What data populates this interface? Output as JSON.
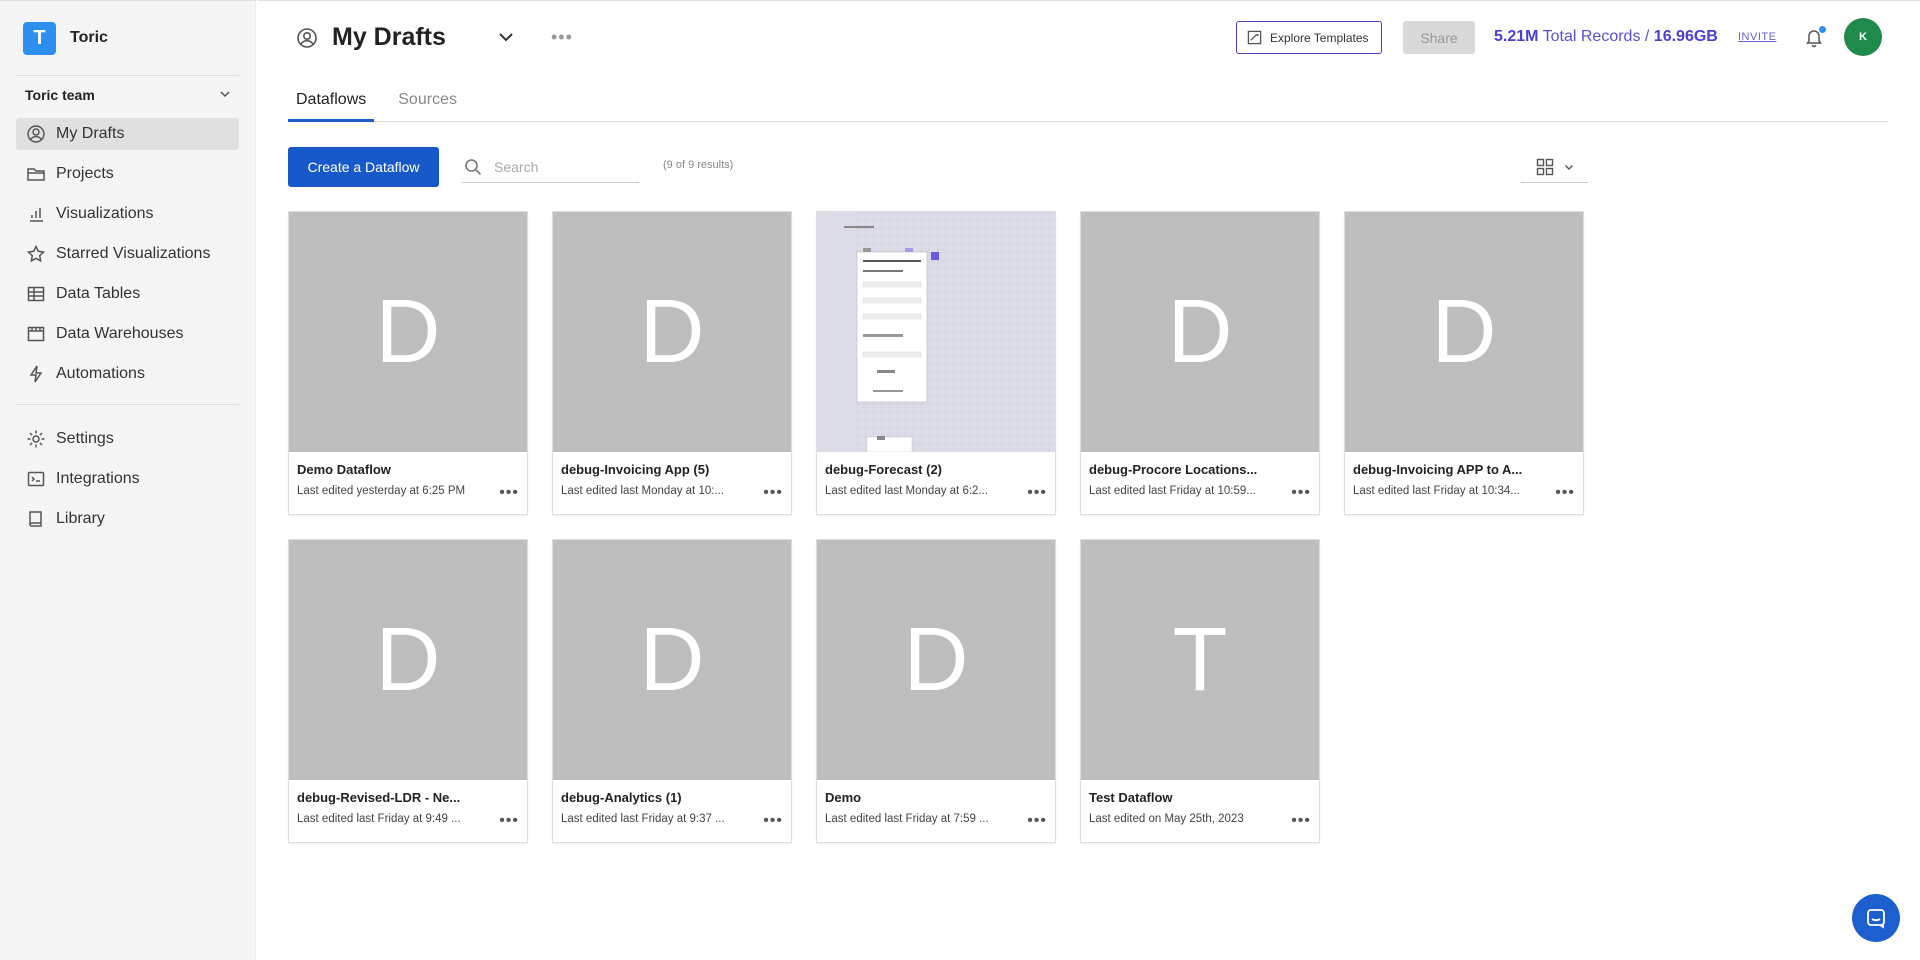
{
  "brand": {
    "logo_letter": "T",
    "name": "Toric"
  },
  "team": {
    "name": "Toric team"
  },
  "sidebar": {
    "items": [
      {
        "label": "My Drafts",
        "icon": "user-circle-icon",
        "active": true
      },
      {
        "label": "Projects",
        "icon": "folder-icon"
      },
      {
        "label": "Visualizations",
        "icon": "chart-icon"
      },
      {
        "label": "Starred Visualizations",
        "icon": "star-icon"
      },
      {
        "label": "Data Tables",
        "icon": "table-icon"
      },
      {
        "label": "Data Warehouses",
        "icon": "warehouse-icon"
      },
      {
        "label": "Automations",
        "icon": "lightning-icon"
      }
    ],
    "secondary": [
      {
        "label": "Settings",
        "icon": "gear-icon"
      },
      {
        "label": "Integrations",
        "icon": "integrations-icon"
      },
      {
        "label": "Library",
        "icon": "book-icon"
      }
    ]
  },
  "header": {
    "title": "My Drafts",
    "explore_label": "Explore Templates",
    "share_label": "Share",
    "records_count": "5.21M",
    "records_label": "Total Records /",
    "storage": "16.96GB",
    "invite_label": "INVITE",
    "avatar_initial": "K"
  },
  "tabs": [
    {
      "label": "Dataflows",
      "active": true
    },
    {
      "label": "Sources",
      "active": false
    }
  ],
  "toolbar": {
    "create_label": "Create a Dataflow",
    "search_placeholder": "Search",
    "results_text": "(9 of 9 results)"
  },
  "cards": [
    {
      "letter": "D",
      "name": "Demo Dataflow",
      "meta": "Last edited yesterday at 6:25 PM"
    },
    {
      "letter": "D",
      "name": "debug-Invoicing App (5)",
      "meta": "Last edited last Monday at 10:..."
    },
    {
      "letter": "",
      "name": "debug-Forecast (2)",
      "meta": "Last edited last Monday at 6:2..."
    },
    {
      "letter": "D",
      "name": "debug-Procore Locations...",
      "meta": "Last edited last Friday at 10:59..."
    },
    {
      "letter": "D",
      "name": "debug-Invoicing APP to A...",
      "meta": "Last edited last Friday at 10:34..."
    },
    {
      "letter": "D",
      "name": "debug-Revised-LDR - Ne...",
      "meta": "Last edited last Friday at 9:49 ..."
    },
    {
      "letter": "D",
      "name": "debug-Analytics (1)",
      "meta": "Last edited last Friday at 9:37 ..."
    },
    {
      "letter": "D",
      "name": "Demo",
      "meta": "Last edited last Friday at 7:59 ..."
    },
    {
      "letter": "T",
      "name": "Test Dataflow",
      "meta": "Last edited on May 25th, 2023"
    }
  ],
  "colors": {
    "primary": "#1859c9",
    "accent": "#4b3fd0",
    "brand": "#2d8ff0",
    "avatar": "#1f8a4c"
  }
}
